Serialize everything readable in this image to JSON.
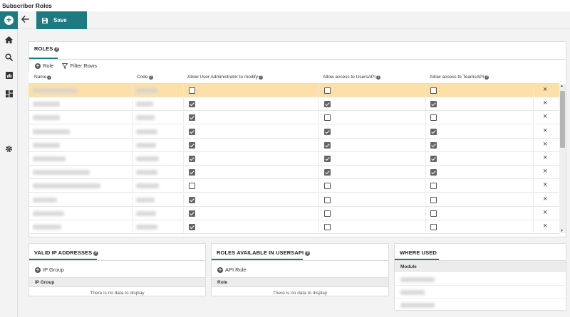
{
  "window": {
    "title": "Subscriber Roles"
  },
  "toolbar": {
    "save_label": "Save"
  },
  "roles": {
    "title": "ROLES",
    "add_label": "Role",
    "filter_label": "Filter Rows",
    "columns": [
      "Name",
      "Code",
      "Allow User Administrator to modify",
      "Allow access to UsersAPI",
      "Allow access to TeamsAPI"
    ],
    "rows": [
      {
        "selected": true,
        "admin": false,
        "users": false,
        "teams": false
      },
      {
        "selected": false,
        "admin": true,
        "users": true,
        "teams": true
      },
      {
        "selected": false,
        "admin": true,
        "users": false,
        "teams": false
      },
      {
        "selected": false,
        "admin": true,
        "users": true,
        "teams": true
      },
      {
        "selected": false,
        "admin": true,
        "users": true,
        "teams": true
      },
      {
        "selected": false,
        "admin": true,
        "users": true,
        "teams": true
      },
      {
        "selected": false,
        "admin": true,
        "users": true,
        "teams": true
      },
      {
        "selected": false,
        "admin": false,
        "users": false,
        "teams": false
      },
      {
        "selected": false,
        "admin": true,
        "users": false,
        "teams": false
      },
      {
        "selected": false,
        "admin": true,
        "users": false,
        "teams": false
      },
      {
        "selected": false,
        "admin": true,
        "users": false,
        "teams": false
      }
    ]
  },
  "ip": {
    "title": "VALID IP ADDRESSES",
    "add_label": "IP Group",
    "column": "IP Group",
    "empty": "There is no data to display"
  },
  "usersapi": {
    "title": "ROLES AVAILABLE IN USERSAPI",
    "add_label": "API Role",
    "column": "Role",
    "empty": "There is no data to display"
  },
  "whereused": {
    "title": "WHERE USED",
    "column": "Module"
  },
  "colors": {
    "accent": "#1d7a80",
    "selected_row": "#fce0a8"
  }
}
